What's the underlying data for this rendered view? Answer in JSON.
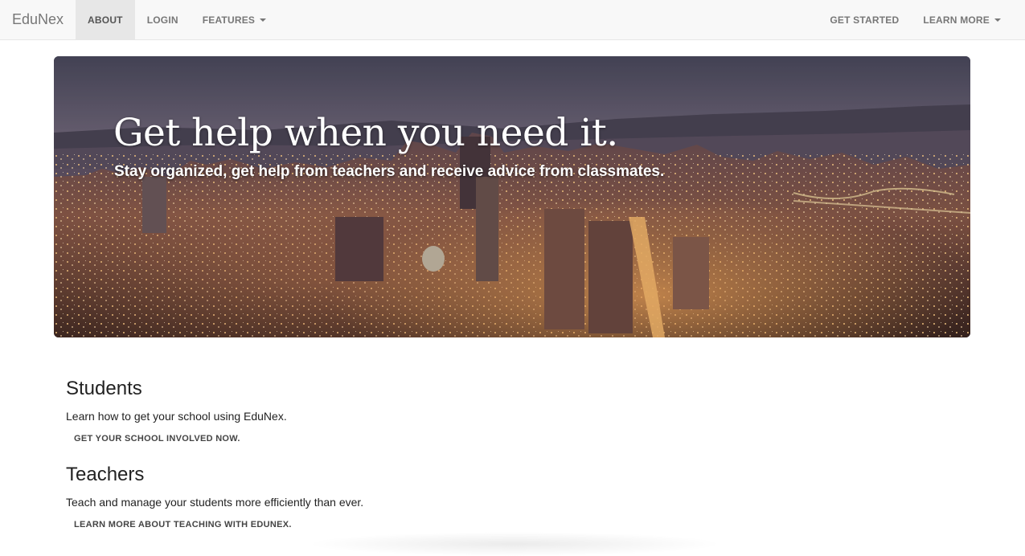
{
  "navbar": {
    "brand": "EduNex",
    "left_items": [
      {
        "label": "ABOUT",
        "active": true
      },
      {
        "label": "LOGIN"
      },
      {
        "label": "FEATURES",
        "dropdown": true
      }
    ],
    "right_items": [
      {
        "label": "GET STARTED"
      },
      {
        "label": "LEARN MORE",
        "dropdown": true
      }
    ]
  },
  "hero": {
    "title": "Get help when you need it.",
    "subtitle": "Stay organized, get help from teachers and receive advice from classmates."
  },
  "sections": [
    {
      "heading": "Students",
      "text": "Learn how to get your school using EduNex.",
      "cta": "GET YOUR SCHOOL INVOLVED NOW."
    },
    {
      "heading": "Teachers",
      "text": "Teach and manage your students more efficiently than ever.",
      "cta": "LEARN MORE ABOUT TEACHING WITH EDUNEX."
    }
  ],
  "colors": {
    "navbar_bg": "#f8f8f8",
    "active_bg": "#e7e7e7",
    "nav_text": "#777777"
  },
  "icons": [
    "caret-down-icon"
  ]
}
